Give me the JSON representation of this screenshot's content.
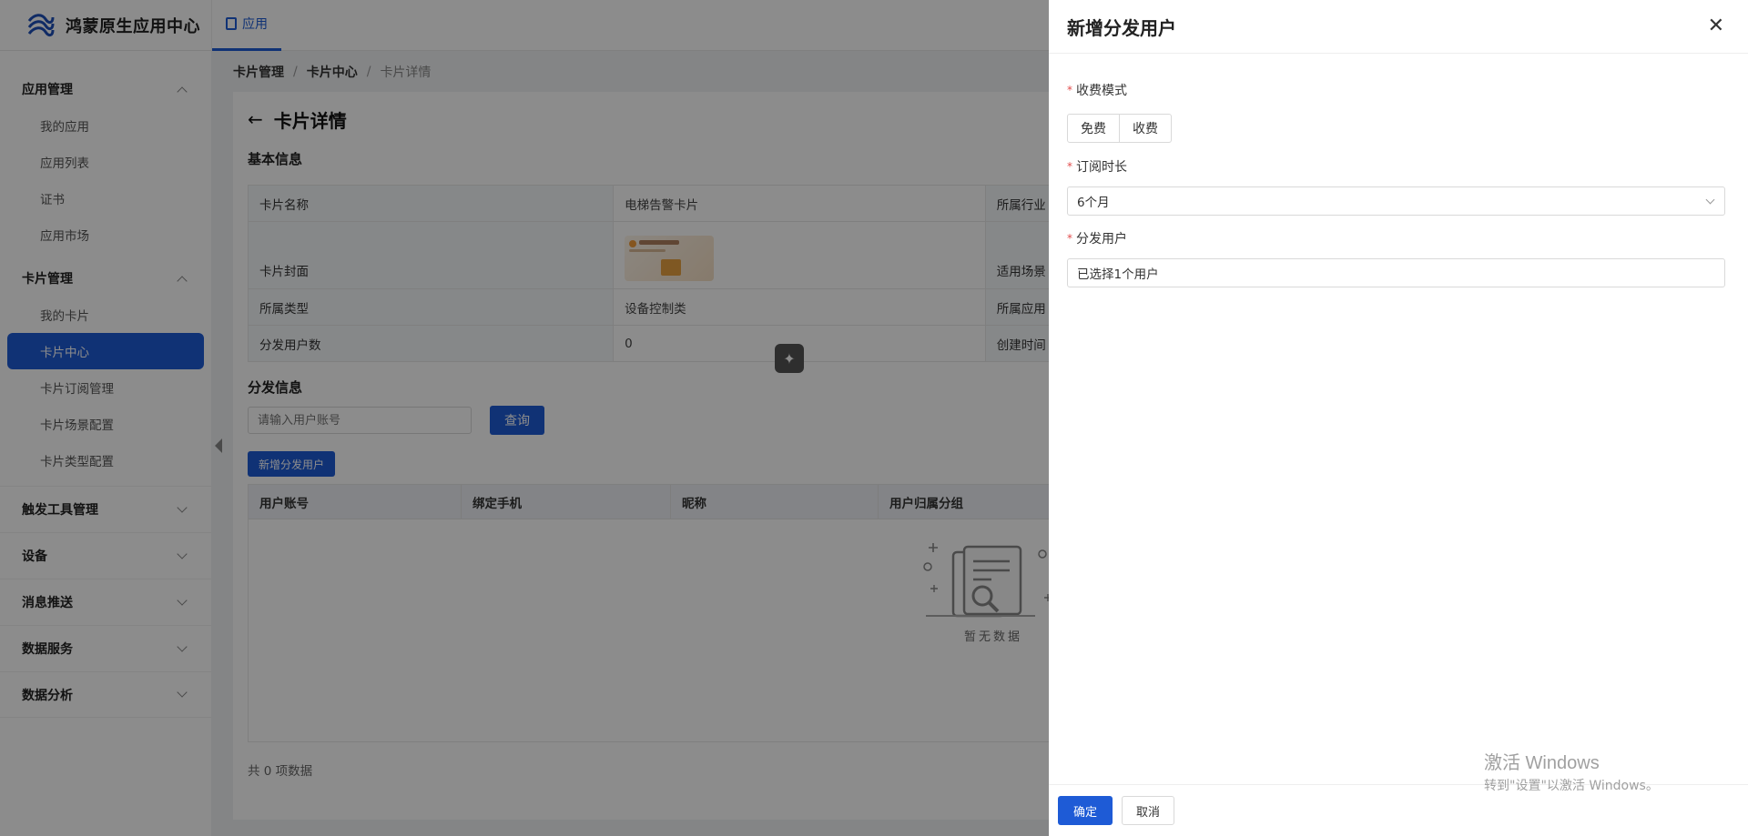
{
  "header": {
    "app_title": "鸿蒙原生应用中心",
    "tab_label": "应用"
  },
  "sidebar": {
    "groups": [
      {
        "label": "应用管理",
        "expanded": true,
        "items": [
          "我的应用",
          "应用列表",
          "证书",
          "应用市场"
        ]
      },
      {
        "label": "卡片管理",
        "expanded": true,
        "items": [
          "我的卡片",
          "卡片中心",
          "卡片订阅管理",
          "卡片场景配置",
          "卡片类型配置"
        ],
        "active_item": "卡片中心"
      },
      {
        "label": "触发工具管理",
        "expanded": false
      },
      {
        "label": "设备",
        "expanded": false
      },
      {
        "label": "消息推送",
        "expanded": false
      },
      {
        "label": "数据服务",
        "expanded": false
      },
      {
        "label": "数据分析",
        "expanded": false
      }
    ]
  },
  "breadcrumb": [
    "卡片管理",
    "卡片中心",
    "卡片详情"
  ],
  "page": {
    "title": "卡片详情",
    "basic_section": "基本信息",
    "info": {
      "card_name_label": "卡片名称",
      "card_name_value": "电梯告警卡片",
      "industry_label": "所属行业",
      "cover_label": "卡片封面",
      "scene_label": "适用场景",
      "type_label": "所属类型",
      "type_value": "设备控制类",
      "app_label": "所属应用",
      "users_label": "分发用户数",
      "users_value": "0",
      "created_label": "创建时间"
    },
    "dist_section": "分发信息",
    "search_placeholder": "请输入用户账号",
    "query_button": "查询",
    "add_button": "新增分发用户",
    "columns": [
      "用户账号",
      "绑定手机",
      "昵称",
      "用户归属分组"
    ],
    "empty_text": "暂无数据",
    "total_text": "共 0 项数据"
  },
  "drawer": {
    "title": "新增分发用户",
    "charge_mode_label": "收费模式",
    "charge_options": [
      "免费",
      "收费"
    ],
    "duration_label": "订阅时长",
    "duration_value": "6个月",
    "users_label": "分发用户",
    "users_value": "已选择1个用户",
    "ok_button": "确定",
    "cancel_button": "取消"
  },
  "watermark": {
    "line1": "激活 Windows",
    "line2": "转到\"设置\"以激活 Windows。"
  },
  "colors": {
    "primary": "#1e5bd6",
    "required": "#e24c4c"
  }
}
